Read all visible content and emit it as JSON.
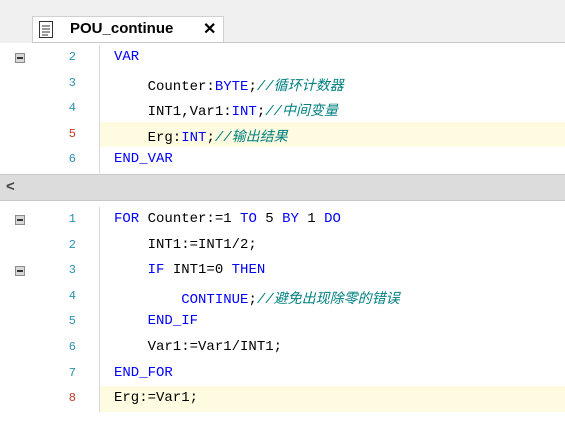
{
  "tab": {
    "title": "POU_continue",
    "close_label": "✕",
    "icon": "document-icon"
  },
  "declaration": {
    "lines": [
      {
        "num": "2",
        "parts": [
          {
            "t": "VAR",
            "c": "kw"
          }
        ]
      },
      {
        "num": "3",
        "parts": [
          {
            "t": "    Counter:",
            "c": ""
          },
          {
            "t": "BYTE",
            "c": "kw"
          },
          {
            "t": ";",
            "c": ""
          },
          {
            "t": "//循环计数器",
            "c": "cm"
          }
        ]
      },
      {
        "num": "4",
        "parts": [
          {
            "t": "    INT1,Var1:",
            "c": ""
          },
          {
            "t": "INT",
            "c": "kw"
          },
          {
            "t": ";",
            "c": ""
          },
          {
            "t": "//中间变量",
            "c": "cm"
          }
        ]
      },
      {
        "num": "5",
        "parts": [
          {
            "t": "    Erg:",
            "c": ""
          },
          {
            "t": "INT",
            "c": "kw"
          },
          {
            "t": ";",
            "c": ""
          },
          {
            "t": "//输出结果",
            "c": "cm"
          }
        ]
      },
      {
        "num": "6",
        "parts": [
          {
            "t": "END_VAR",
            "c": "kw"
          }
        ]
      }
    ]
  },
  "body": {
    "lines": [
      {
        "num": "1",
        "parts": [
          {
            "t": "FOR",
            "c": "kw"
          },
          {
            "t": " Counter:=",
            "c": ""
          },
          {
            "t": "1",
            "c": "num"
          },
          {
            "t": " ",
            "c": ""
          },
          {
            "t": "TO",
            "c": "kw"
          },
          {
            "t": " 5 ",
            "c": ""
          },
          {
            "t": "BY",
            "c": "kw"
          },
          {
            "t": " 1 ",
            "c": ""
          },
          {
            "t": "DO",
            "c": "kw"
          }
        ]
      },
      {
        "num": "2",
        "parts": [
          {
            "t": "    INT1:=INT1/2;",
            "c": ""
          }
        ]
      },
      {
        "num": "3",
        "parts": [
          {
            "t": "    ",
            "c": ""
          },
          {
            "t": "IF",
            "c": "kw"
          },
          {
            "t": " INT1=0 ",
            "c": ""
          },
          {
            "t": "THEN",
            "c": "kw"
          }
        ]
      },
      {
        "num": "4",
        "parts": [
          {
            "t": "        ",
            "c": ""
          },
          {
            "t": "CONTINUE",
            "c": "kw"
          },
          {
            "t": ";",
            "c": ""
          },
          {
            "t": "//避免出现除零的错误",
            "c": "cm"
          }
        ]
      },
      {
        "num": "5",
        "parts": [
          {
            "t": "    ",
            "c": ""
          },
          {
            "t": "END_IF",
            "c": "kw"
          }
        ]
      },
      {
        "num": "6",
        "parts": [
          {
            "t": "    Var1:=Var1/INT1;",
            "c": ""
          }
        ]
      },
      {
        "num": "7",
        "parts": [
          {
            "t": "END_FOR",
            "c": "kw"
          }
        ]
      },
      {
        "num": "8",
        "parts": [
          {
            "t": "Erg:=Var1;",
            "c": ""
          }
        ]
      }
    ]
  },
  "splitter": {
    "arrow": "<"
  },
  "colors": {
    "keyword": "#0000ff",
    "comment": "#008080",
    "line_number": "#2b91af",
    "modified_line_number": "#c0392b",
    "highlight": "#fffbe0"
  }
}
